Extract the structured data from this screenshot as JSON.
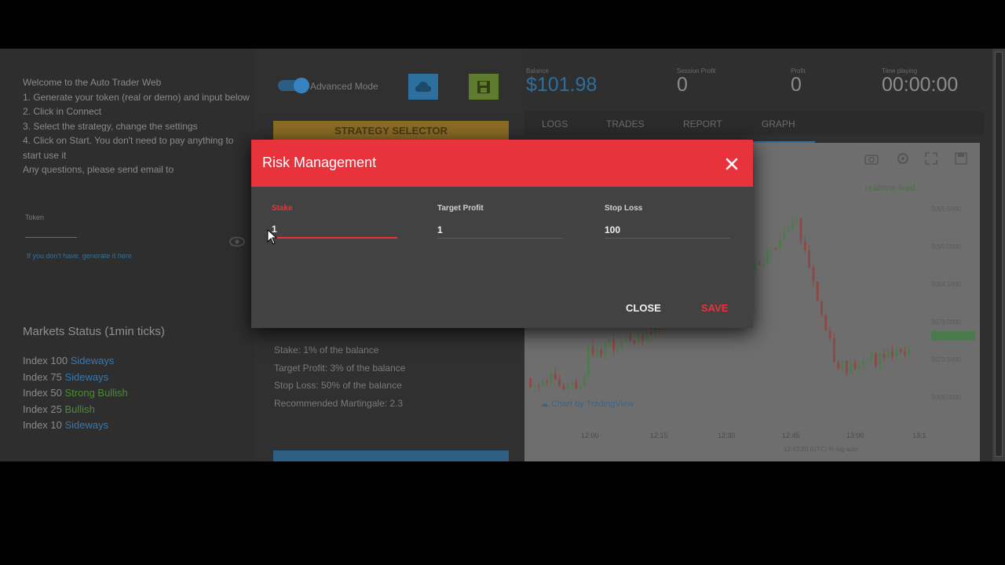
{
  "left": {
    "welcome_lines": [
      "Welcome to the Auto Trader Web",
      "1. Generate your token (real or demo) and input below",
      "2. Click in Connect",
      "3. Select the strategy, change the settings",
      "4. Click on Start. You don't need to pay anything to start use it",
      "Any questions, please send email to"
    ],
    "token_label": "Token",
    "token_link": "If you don't have, generate it here",
    "markets_title": "Markets Status (1min ticks)",
    "markets": [
      {
        "name": "Index 100",
        "status": "Sideways",
        "color": "#3579b0"
      },
      {
        "name": "Index 75",
        "status": "Sideways",
        "color": "#3579b0"
      },
      {
        "name": "Index 50",
        "status": "Strong Bullish",
        "color": "#4e8a3a"
      },
      {
        "name": "Index 25",
        "status": "Bullish",
        "color": "#4e8a3a"
      },
      {
        "name": "Index 10",
        "status": "Sideways",
        "color": "#3579b0"
      }
    ]
  },
  "middle": {
    "advanced_mode": "Advanced Mode",
    "strategy_button": "STRATEGY SELECTOR",
    "info": [
      "Stake: 1% of the balance",
      "Target Profit: 3% of the balance",
      "Stop Loss: 50% of the balance",
      "Recommended Martingale: 2.3"
    ]
  },
  "stats": {
    "balance_label": "Balance",
    "balance": "$101.98",
    "session_profit_label": "Session Profit",
    "session_profit": "0",
    "profit_label": "Profit",
    "profit": "0",
    "time_label": "Time playing",
    "time": "00:00:00"
  },
  "tabs": [
    "LOGS",
    "TRADES",
    "REPORT",
    "GRAPH"
  ],
  "chart": {
    "realtime": "realtime feed",
    "price_ticks": [
      "3095.5000",
      "3090.0000",
      "3084.5000",
      "3079.0000",
      "3073.5000",
      "3068.0000",
      "3062.5000"
    ],
    "time_ticks": [
      "12:00",
      "12:15",
      "12:30",
      "12:45",
      "13:00",
      "13:1"
    ],
    "watermark": "Chart by TradingView",
    "footer": "12:43:20 (UTC)  %  log  auto"
  },
  "modal": {
    "title": "Risk Management",
    "stake_label": "Stake",
    "stake_value": "1",
    "target_label": "Target Profit",
    "target_value": "1",
    "stop_label": "Stop Loss",
    "stop_value": "100",
    "close": "CLOSE",
    "save": "SAVE"
  },
  "colors": {
    "accent_red": "#e8323c",
    "accent_blue": "#2f6e9c"
  }
}
